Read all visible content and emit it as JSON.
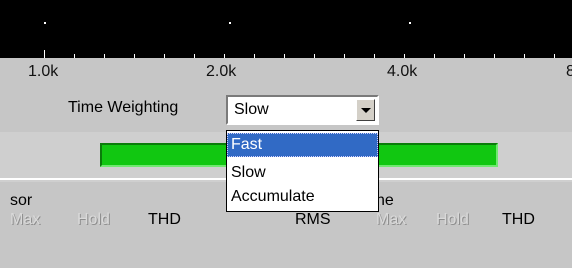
{
  "frequency_scale": {
    "labels": [
      "1.0k",
      "2.0k",
      "4.0k",
      "8"
    ]
  },
  "time_weighting": {
    "label": "Time Weighting",
    "selected": "Slow",
    "options": [
      "Fast",
      "Slow",
      "Accumulate"
    ],
    "highlighted": "Fast"
  },
  "level_meter": {
    "color": "#11c711"
  },
  "left_channel": {
    "name_fragment": "sor",
    "max": "Max",
    "hold": "Hold",
    "thd": "THD"
  },
  "right_channel": {
    "name_fragment": "ne",
    "rms": "RMS",
    "max": "Max",
    "hold": "Hold",
    "thd": "THD"
  },
  "colors": {
    "background": "#c6c6c6",
    "scale_background": "#000000",
    "selection": "#316ac5",
    "meter_green": "#11c711"
  }
}
